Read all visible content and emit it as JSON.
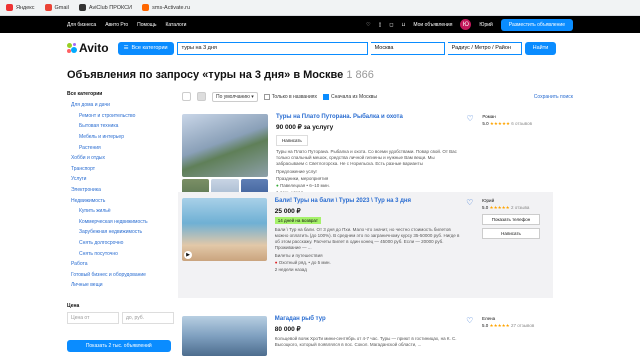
{
  "bookmarks": [
    "Яндекс",
    "Gmail",
    "AviClub ПРОКСИ",
    "sms-Activate.ru"
  ],
  "topbar": {
    "links": [
      "Для бизнеса",
      "Авито Pro",
      "Помощь",
      "Каталоги"
    ],
    "my_ads": "Мои объявления",
    "user": "Юрий",
    "avatar": "Ю",
    "post": "Разместить объявление"
  },
  "search": {
    "logo": "Avito",
    "categories": "Все категории",
    "query": "туры на 3 дня",
    "city": "Москва",
    "radius": "Радиус / Метро / Район",
    "find": "Найти"
  },
  "title": {
    "text": "Объявления по запросу «туры на 3 дня» в Москве",
    "count": "1 866"
  },
  "sidebar": {
    "heading": "Все категории",
    "items": [
      "Для дома и дачи",
      "Ремонт и строительство",
      "Бытовая техника",
      "Мебель и интерьер",
      "Растения",
      "Хобби и отдых",
      "Транспорт",
      "Услуги",
      "Электроника",
      "Недвижимость",
      "Купить жильё",
      "Коммерческая недвижимость",
      "Зарубежная недвижимость",
      "Снять долгосрочно",
      "Снять посуточно",
      "Работа",
      "Готовый бизнес и оборудование",
      "Личные вещи"
    ],
    "price": "Цена",
    "from": "Цена от",
    "to": "до, руб.",
    "show": "Показать 2 тыс. объявлений"
  },
  "controls": {
    "sort": "По умолчанию",
    "names": "Только в названиях",
    "moscow": "Сначала из Москвы",
    "save": "Сохранить поиск"
  },
  "cards": [
    {
      "title": "Туры на Плато Путорана. Рыбалка и охота",
      "price": "90 000 ₽ за услугу",
      "write": "Написать",
      "desc": "Туры на Плато Путорана. Рыбалка и охота. Со всеми удобствами. Повар свой. От Вас только спальный мешок, средства личной гигиены и нужные Вам вещи. Мы забрасываем с Светлогорска. Не с Норильска. Есть разные варианты",
      "cat1": "Предложение услуг",
      "cat2": "Праздники, мероприятия",
      "loc": "Павелецкая • 6–10 мин.",
      "date": "1 день назад",
      "seller": "Роман",
      "rating": "5.0",
      "reviews": "6 отзывов"
    },
    {
      "title": "Бали! Туры на бали \\ Туры 2023 \\ Тур на 3 дня",
      "price": "25 000 ₽",
      "badge": "14 дней на возврат",
      "desc": "Бали \\ Тур на бали. От 3 дня до Пхи. Мало что значит, но честно стоимость билетов можно оплатить (до 100%). В среднем это по заграничному курсу 35-50000 руб. Нигде в об этом расскажу. Расчеты Билет в один конец — 45000 руб. Если — 20000 руб. Проживание — ...",
      "cat1": "Билеты и путешествия",
      "loc": "Охотный ряд, • до 5 мин.",
      "date": "2 недели назад",
      "seller": "Юрий",
      "rating": "5.0",
      "reviews": "2 отзыва",
      "phone": "Показать телефон",
      "write": "Написать"
    },
    {
      "title": "Магадан рыб тур",
      "price": "80 000 ₽",
      "desc": "Кольцевой вояж ХроТи мини-сентябрь от 4-7 час. Туры — приют в гостиницах, на К. С. Высоцкого, который появлялся в пос. Сокол. Магаданской области, ...",
      "seller": "Елена",
      "rating": "5.0",
      "reviews": "27 отзывов"
    }
  ]
}
